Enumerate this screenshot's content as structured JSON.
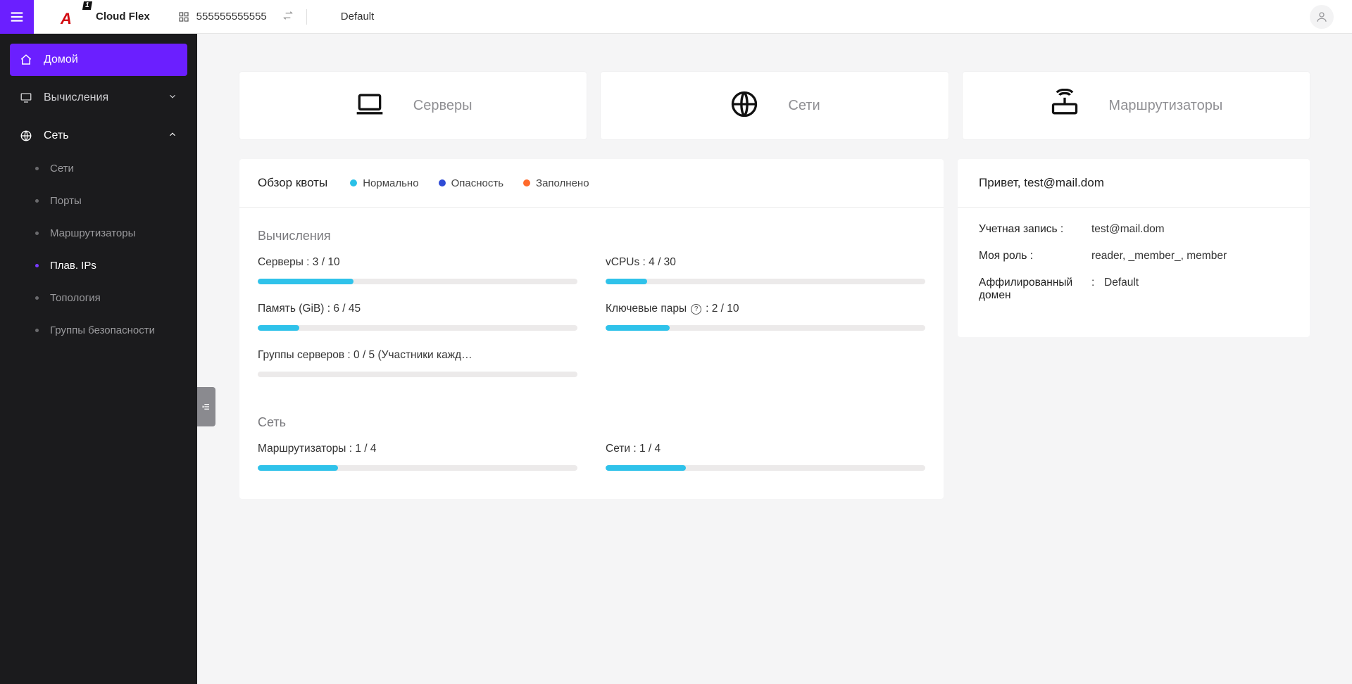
{
  "header": {
    "brand": "Cloud Flex",
    "account_id": "555555555555",
    "project": "Default"
  },
  "sidebar": {
    "home": "Домой",
    "compute": "Вычисления",
    "network": "Сеть",
    "items": {
      "nets": "Сети",
      "ports": "Порты",
      "routers": "Маршрутизаторы",
      "fips": "Плав. IPs",
      "topology": "Топология",
      "secgroups": "Группы безопасности"
    }
  },
  "tiles": {
    "servers": "Серверы",
    "networks": "Сети",
    "routers": "Маршрутизаторы"
  },
  "quota": {
    "title": "Обзор квоты",
    "legend": {
      "normal": "Нормально",
      "warn": "Опасность",
      "full": "Заполнено"
    },
    "compute_title": "Вычисления",
    "network_title": "Сеть",
    "metrics": {
      "servers": {
        "label": "Серверы : 3 / 10",
        "pct": 30
      },
      "vcpus": {
        "label": "vCPUs : 4 / 30",
        "pct": 13
      },
      "memory": {
        "label": "Память (GiB) : 6 / 45",
        "pct": 13
      },
      "keypairs": {
        "label": "Ключевые пары",
        "value": ": 2 / 10",
        "pct": 20,
        "help": true
      },
      "sgroups": {
        "label": "Группы серверов : 0 / 5 (Участники кажд…",
        "pct": 0
      },
      "routers": {
        "label": "Маршрутизаторы : 1 / 4",
        "pct": 25
      },
      "nets": {
        "label": "Сети : 1 / 4",
        "pct": 25
      }
    }
  },
  "user": {
    "hello": "Привет, test@mail.dom",
    "rows": {
      "account_k": "Учетная запись :",
      "account_v": "test@mail.dom",
      "role_k": "Моя роль :",
      "role_v": "reader, _member_, member",
      "domain_k": "Аффилированный домен",
      "domain_colon": ":",
      "domain_v": "Default"
    }
  }
}
